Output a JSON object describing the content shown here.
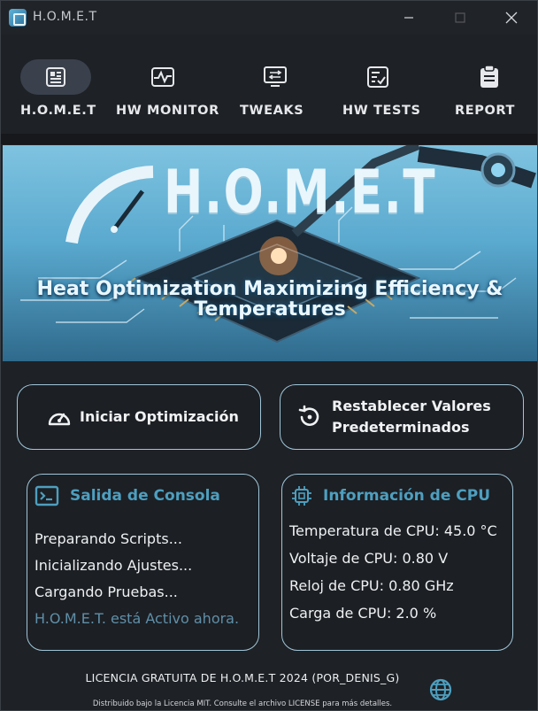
{
  "window": {
    "title": "H.O.M.E.T"
  },
  "nav": {
    "items": [
      {
        "label": "H.O.M.E.T",
        "icon": "chip-icon",
        "active": true
      },
      {
        "label": "HW MONITOR",
        "icon": "pulse-monitor-icon",
        "active": false
      },
      {
        "label": "TWEAKS",
        "icon": "tweaks-monitor-icon",
        "active": false
      },
      {
        "label": "HW TESTS",
        "icon": "checklist-icon",
        "active": false
      },
      {
        "label": "REPORT",
        "icon": "clipboard-icon",
        "active": false
      }
    ]
  },
  "banner": {
    "brand": "H.O.M.E.T",
    "tagline_line1": "Heat Optimization Maximizing Efficiency &",
    "tagline_line2": "Temperatures"
  },
  "actions": {
    "optimize_label": "Iniciar Optimización",
    "reset_label_line1": "Restablecer Valores",
    "reset_label_line2": "Predeterminados"
  },
  "console": {
    "title": "Salida de Consola",
    "lines": [
      "Preparando Scripts...",
      "Inicializando Ajustes...",
      "Cargando Pruebas...",
      "H.O.M.E.T. está Activo ahora."
    ]
  },
  "cpu": {
    "title": "Información de CPU",
    "lines": [
      "Temperatura de CPU: 45.0 °C",
      "Voltaje de CPU: 0.80 V",
      "Reloj de CPU: 0.80 GHz",
      "Carga de CPU: 2.0 %"
    ]
  },
  "footer": {
    "license": "LICENCIA GRATUITA DE H.O.M.E.T 2024 (POR_DENIS_G)",
    "mit_note": "Distribuido bajo la Licencia MIT. Consulte el archivo LICENSE para más detalles."
  },
  "colors": {
    "accent": "#4d9fbf",
    "border": "#9fc6d8",
    "background": "#1e2126",
    "active_nav": "#3a414c"
  }
}
